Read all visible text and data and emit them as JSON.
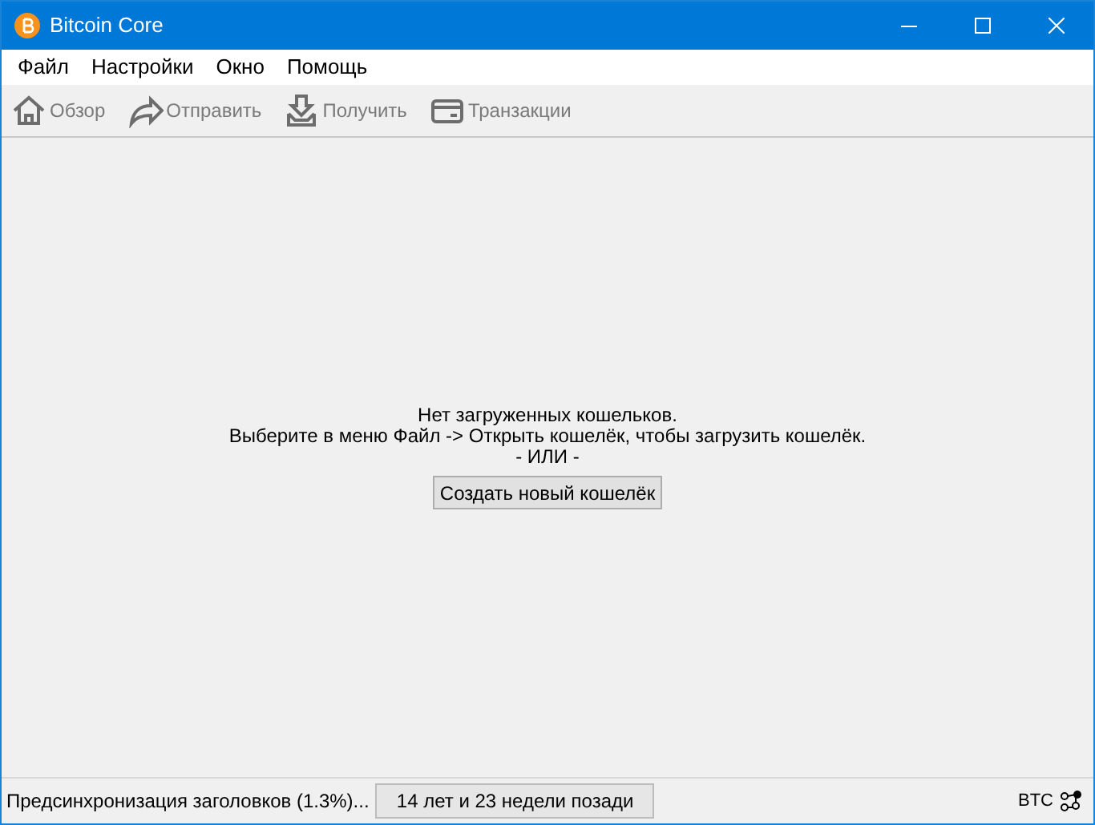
{
  "window": {
    "title": "Bitcoin Core"
  },
  "menu": [
    "Файл",
    "Настройки",
    "Окно",
    "Помощь"
  ],
  "toolbar": [
    {
      "kind": "home",
      "label": "Обзор",
      "disabled": true
    },
    {
      "kind": "send",
      "label": "Отправить",
      "disabled": true
    },
    {
      "kind": "receive",
      "label": "Получить",
      "disabled": true
    },
    {
      "kind": "transactions",
      "label": "Транзакции",
      "disabled": true
    }
  ],
  "message": {
    "lines": [
      "Нет загруженных кошельков.",
      "Выберите в меню Файл -> Открыть кошелёк, чтобы загрузить кошелёк.",
      "- ИЛИ -"
    ],
    "button": "Создать новый кошелёк"
  },
  "status_bar": {
    "sync_text": "Предсинхронизация заголовков (1.3%)...",
    "age": "14 лет и 23 недели позади",
    "unit": "BTC"
  }
}
